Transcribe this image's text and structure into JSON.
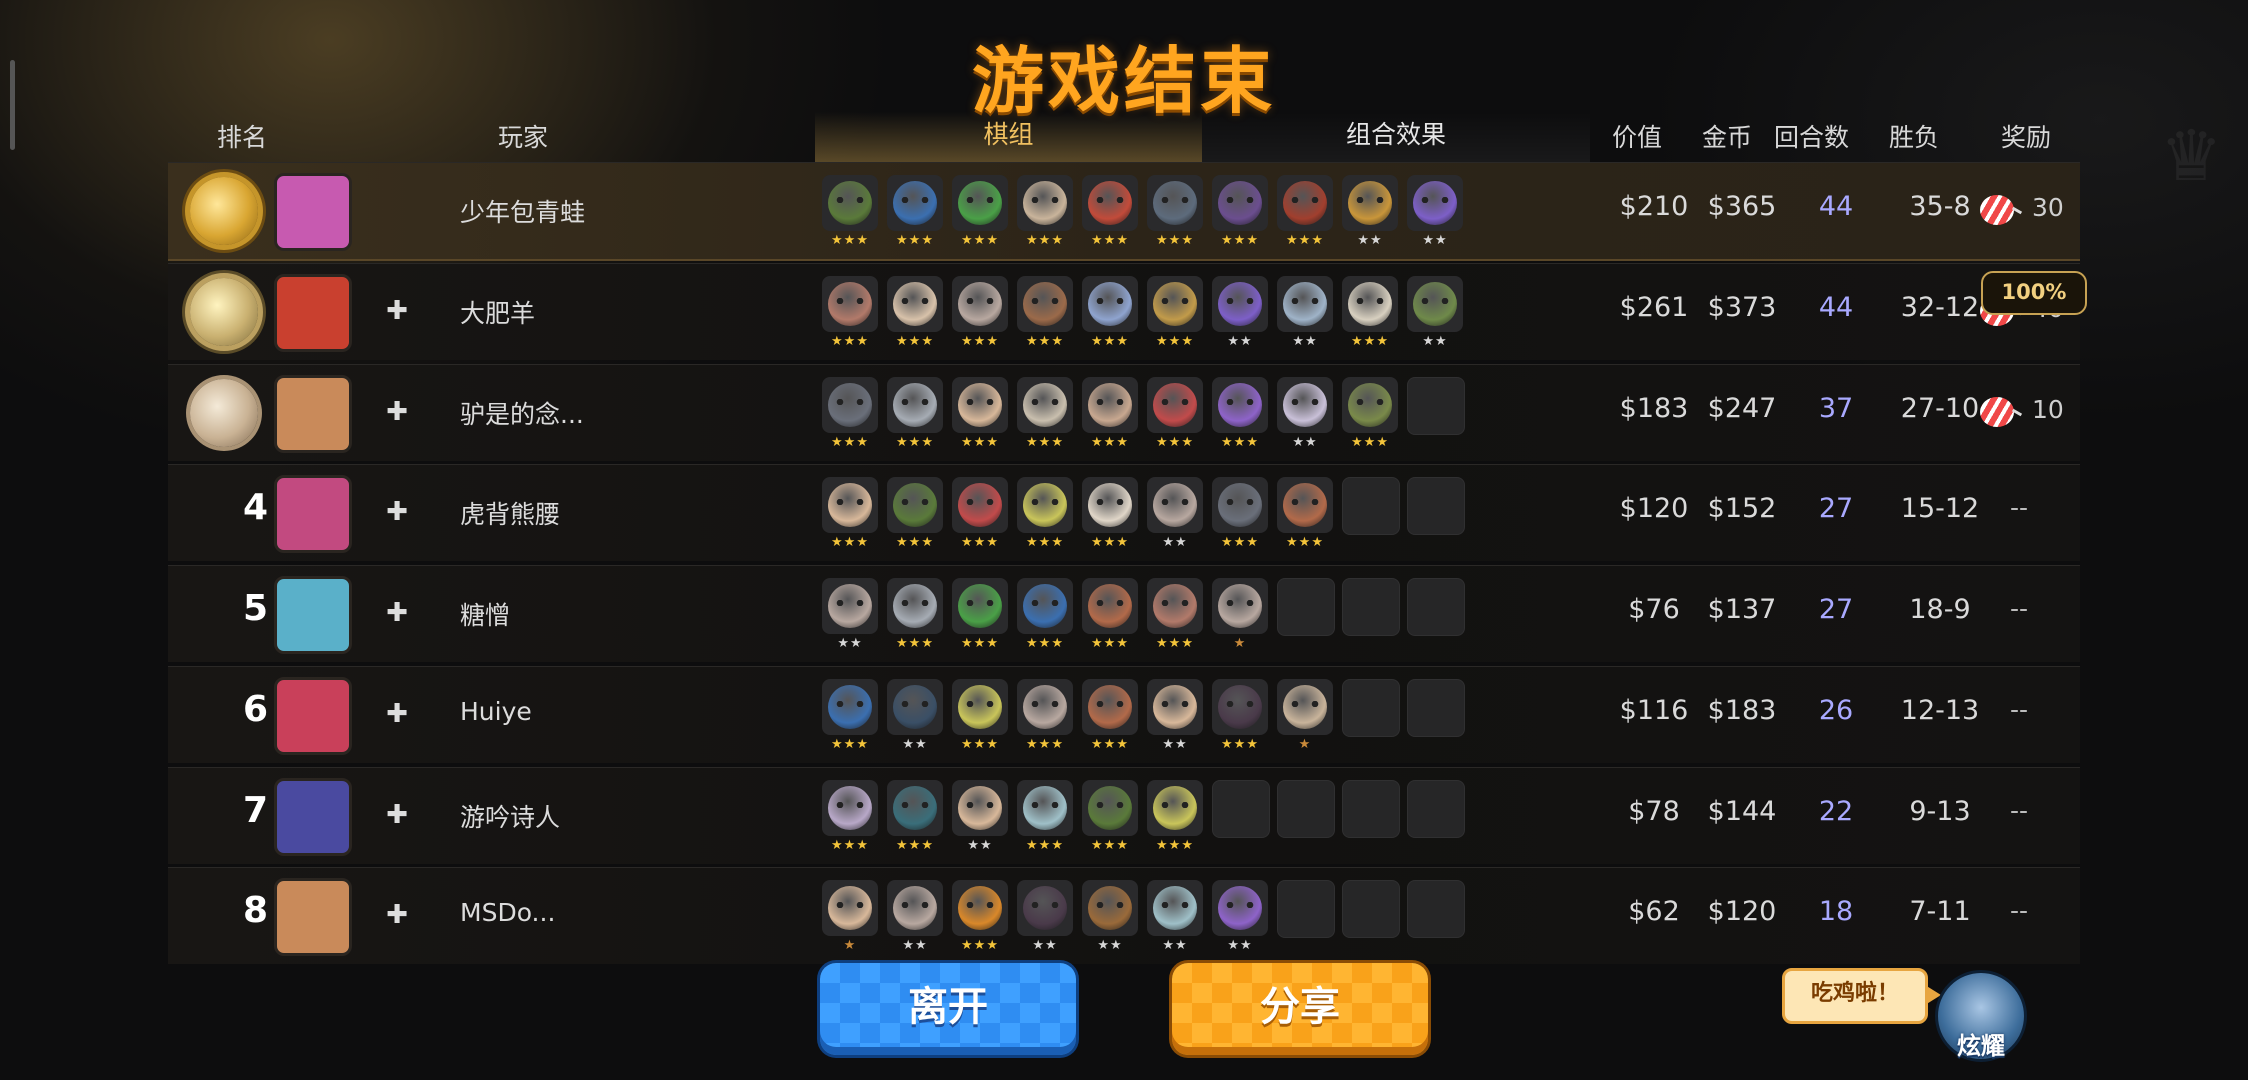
{
  "title": "游戏结束",
  "headers": {
    "rank": "排名",
    "player": "玩家",
    "pieces_tab": "棋组",
    "synergy_tab": "组合效果",
    "value": "价值",
    "gold": "金币",
    "rounds": "回合数",
    "winloss": "胜负",
    "reward": "奖励"
  },
  "pct_badge": "100%",
  "rows": [
    {
      "rank_display": "",
      "medal": "gold",
      "player": "少年包青蛙",
      "value": "$210",
      "gold": "$365",
      "rounds": "44",
      "winloss": "35-8",
      "reward": "30",
      "has_reward": true
    },
    {
      "rank_display": "",
      "medal": "silver",
      "player": "大肥羊",
      "value": "$261",
      "gold": "$373",
      "rounds": "44",
      "winloss": "32-12",
      "reward": "40",
      "has_reward": true
    },
    {
      "rank_display": "",
      "medal": "bronze",
      "player": "驴是的念...",
      "value": "$183",
      "gold": "$247",
      "rounds": "37",
      "winloss": "27-10",
      "reward": "10",
      "has_reward": true
    },
    {
      "rank_display": "4",
      "player": "虎背熊腰",
      "value": "$120",
      "gold": "$152",
      "rounds": "27",
      "winloss": "15-12",
      "reward": "--",
      "has_reward": false
    },
    {
      "rank_display": "5",
      "player": "糖憎",
      "value": "$76",
      "gold": "$137",
      "rounds": "27",
      "winloss": "18-9",
      "reward": "--",
      "has_reward": false
    },
    {
      "rank_display": "6",
      "player": "Huiye",
      "value": "$116",
      "gold": "$183",
      "rounds": "26",
      "winloss": "12-13",
      "reward": "--",
      "has_reward": false
    },
    {
      "rank_display": "7",
      "player": "游吟诗人",
      "value": "$78",
      "gold": "$144",
      "rounds": "22",
      "winloss": "9-13",
      "reward": "--",
      "has_reward": false
    },
    {
      "rank_display": "8",
      "player": "MSDo...",
      "value": "$62",
      "gold": "$120",
      "rounds": "18",
      "winloss": "7-11",
      "reward": "--",
      "has_reward": false
    }
  ],
  "pieces": [
    [
      {
        "c": "#5a7a3a",
        "s": 3,
        "t": "gold"
      },
      {
        "c": "#3b6fb0",
        "s": 3,
        "t": "gold"
      },
      {
        "c": "#4aa047",
        "s": 3,
        "t": "gold"
      },
      {
        "c": "#c9b49b",
        "s": 3,
        "t": "gold"
      },
      {
        "c": "#c24b3a",
        "s": 3,
        "t": "gold"
      },
      {
        "c": "#5d6b7c",
        "s": 3,
        "t": "gold"
      },
      {
        "c": "#6b4e8f",
        "s": 3,
        "t": "gold"
      },
      {
        "c": "#a13f2e",
        "s": 3,
        "t": "gold"
      },
      {
        "c": "#c9963a",
        "s": 2,
        "t": "silver"
      },
      {
        "c": "#7d5fc8",
        "s": 2,
        "t": "silver"
      }
    ],
    [
      {
        "c": "#b27a6a",
        "s": 3,
        "t": "gold"
      },
      {
        "c": "#d8c2aa",
        "s": 3,
        "t": "gold"
      },
      {
        "c": "#b8a8a0",
        "s": 3,
        "t": "gold"
      },
      {
        "c": "#9b6a4a",
        "s": 3,
        "t": "gold"
      },
      {
        "c": "#8fa4cf",
        "s": 3,
        "t": "gold"
      },
      {
        "c": "#c29b4a",
        "s": 3,
        "t": "gold"
      },
      {
        "c": "#7d5fc8",
        "s": 2,
        "t": "silver"
      },
      {
        "c": "#9fb3c8",
        "s": 2,
        "t": "silver"
      },
      {
        "c": "#d8d0c0",
        "s": 3,
        "t": "gold"
      },
      {
        "c": "#6f8a4a",
        "s": 2,
        "t": "silver"
      }
    ],
    [
      {
        "c": "#6a6f7a",
        "s": 3,
        "t": "gold"
      },
      {
        "c": "#a6acb4",
        "s": 3,
        "t": "gold"
      },
      {
        "c": "#d8b89a",
        "s": 3,
        "t": "gold"
      },
      {
        "c": "#c9bfae",
        "s": 3,
        "t": "gold"
      },
      {
        "c": "#c8a890",
        "s": 3,
        "t": "gold"
      },
      {
        "c": "#c24b4b",
        "s": 3,
        "t": "gold"
      },
      {
        "c": "#8e63c9",
        "s": 3,
        "t": "gold"
      },
      {
        "c": "#c9c0d8",
        "s": 2,
        "t": "silver"
      },
      {
        "c": "#7a8a4a",
        "s": 3,
        "t": "gold"
      },
      {
        "empty": true
      }
    ],
    [
      {
        "c": "#d8b89a",
        "s": 3,
        "t": "gold"
      },
      {
        "c": "#5a7a3a",
        "s": 3,
        "t": "gold"
      },
      {
        "c": "#c24b4b",
        "s": 3,
        "t": "gold"
      },
      {
        "c": "#c9c55a",
        "s": 3,
        "t": "gold"
      },
      {
        "c": "#e0d6c8",
        "s": 3,
        "t": "gold"
      },
      {
        "c": "#b8a8a0",
        "s": 2,
        "t": "silver"
      },
      {
        "c": "#6a6f7a",
        "s": 3,
        "t": "gold"
      },
      {
        "c": "#b26a4a",
        "s": 3,
        "t": "gold"
      },
      {
        "empty": true
      },
      {
        "empty": true
      }
    ],
    [
      {
        "c": "#b8a8a0",
        "s": 2,
        "t": "silver"
      },
      {
        "c": "#a6acb4",
        "s": 3,
        "t": "gold"
      },
      {
        "c": "#4aa047",
        "s": 3,
        "t": "gold"
      },
      {
        "c": "#3b6fb0",
        "s": 3,
        "t": "gold"
      },
      {
        "c": "#b26a4a",
        "s": 3,
        "t": "gold"
      },
      {
        "c": "#b27a6a",
        "s": 3,
        "t": "gold"
      },
      {
        "c": "#b8a8a0",
        "s": 1,
        "t": "bronze"
      },
      {
        "empty": true
      },
      {
        "empty": true
      },
      {
        "empty": true
      }
    ],
    [
      {
        "c": "#3b6fb0",
        "s": 3,
        "t": "gold"
      },
      {
        "c": "#3a4f66",
        "s": 2,
        "t": "silver"
      },
      {
        "c": "#c9c55a",
        "s": 3,
        "t": "gold"
      },
      {
        "c": "#b8a8a0",
        "s": 3,
        "t": "gold"
      },
      {
        "c": "#b26a4a",
        "s": 3,
        "t": "gold"
      },
      {
        "c": "#d8b89a",
        "s": 2,
        "t": "silver"
      },
      {
        "c": "#4a3a4a",
        "s": 3,
        "t": "gold"
      },
      {
        "c": "#c9b49b",
        "s": 1,
        "t": "bronze"
      },
      {
        "empty": true
      },
      {
        "empty": true
      }
    ],
    [
      {
        "c": "#b8a8c8",
        "s": 3,
        "t": "gold"
      },
      {
        "c": "#3a6e7a",
        "s": 3,
        "t": "gold"
      },
      {
        "c": "#d8b89a",
        "s": 2,
        "t": "silver"
      },
      {
        "c": "#9fc0c8",
        "s": 3,
        "t": "gold"
      },
      {
        "c": "#5a7a3a",
        "s": 3,
        "t": "gold"
      },
      {
        "c": "#c9c55a",
        "s": 3,
        "t": "gold"
      },
      {
        "empty": true
      },
      {
        "empty": true
      },
      {
        "empty": true
      },
      {
        "empty": true
      }
    ],
    [
      {
        "c": "#d8b89a",
        "s": 1,
        "t": "bronze"
      },
      {
        "c": "#b8a8a0",
        "s": 2,
        "t": "silver"
      },
      {
        "c": "#d9882a",
        "s": 3,
        "t": "gold"
      },
      {
        "c": "#4a3a4a",
        "s": 2,
        "t": "silver"
      },
      {
        "c": "#9a6a3a",
        "s": 2,
        "t": "silver"
      },
      {
        "c": "#9fc0c8",
        "s": 2,
        "t": "silver"
      },
      {
        "c": "#8e63c9",
        "s": 2,
        "t": "silver"
      },
      {
        "empty": true
      },
      {
        "empty": true
      },
      {
        "empty": true
      }
    ]
  ],
  "avatars": [
    "#c75ab0",
    "#c9402f",
    "#c98a5a",
    "#c24a80",
    "#5ab0c9",
    "#c9405a",
    "#4a4aa0",
    "#c98a5a"
  ],
  "buttons": {
    "leave": "离开",
    "share": "分享"
  },
  "bubble": "吃鸡啦！",
  "mascot_label": "炫耀"
}
